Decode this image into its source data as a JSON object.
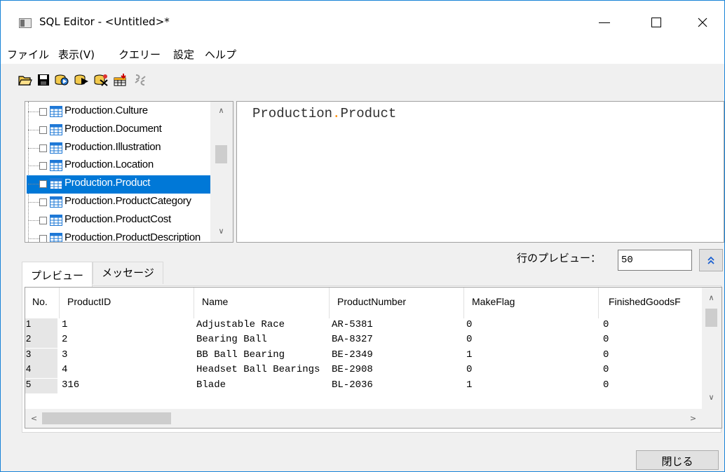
{
  "window": {
    "title": "SQL Editor - <Untitled>*"
  },
  "menu": [
    "ファイル",
    "表示(V)",
    "クエリー",
    "設定",
    "ヘルプ"
  ],
  "toolbar": {
    "icons": [
      "open-folder-icon",
      "save-icon",
      "run-query-icon",
      "run-query-step-icon",
      "query-builder-icon",
      "import-table-icon",
      "disconnect-icon"
    ]
  },
  "tree": {
    "items": [
      "Production.Culture",
      "Production.Document",
      "Production.Illustration",
      "Production.Location",
      "Production.Product",
      "Production.ProductCategory",
      "Production.ProductCost",
      "Production.ProductDescription"
    ],
    "selected_index": 4
  },
  "editor": {
    "schema": "Production",
    "separator": ".",
    "object": "Product"
  },
  "preview": {
    "label": "行のプレビュー：",
    "rows_value": "50"
  },
  "tabs": {
    "preview": "プレビュー",
    "messages": "メッセージ"
  },
  "grid": {
    "columns": [
      "No.",
      "ProductID",
      "Name",
      "ProductNumber",
      "MakeFlag",
      "FinishedGoodsF"
    ],
    "rows": [
      {
        "no": "1",
        "cells": [
          "1",
          "Adjustable Race",
          "AR-5381",
          "0",
          "0"
        ]
      },
      {
        "no": "2",
        "cells": [
          "2",
          "Bearing Ball",
          "BA-8327",
          "0",
          "0"
        ]
      },
      {
        "no": "3",
        "cells": [
          "3",
          "BB Ball Bearing",
          "BE-2349",
          "1",
          "0"
        ]
      },
      {
        "no": "4",
        "cells": [
          "4",
          "Headset Ball Bearings",
          "BE-2908",
          "0",
          "0"
        ]
      },
      {
        "no": "5",
        "cells": [
          "316",
          "Blade",
          "BL-2036",
          "1",
          "0"
        ]
      }
    ]
  },
  "footer": {
    "close_label": "閉じる"
  },
  "colors": {
    "selection": "#0078d7",
    "border_accent": "#1883d7",
    "keyword_dot": "#ff8c00"
  }
}
